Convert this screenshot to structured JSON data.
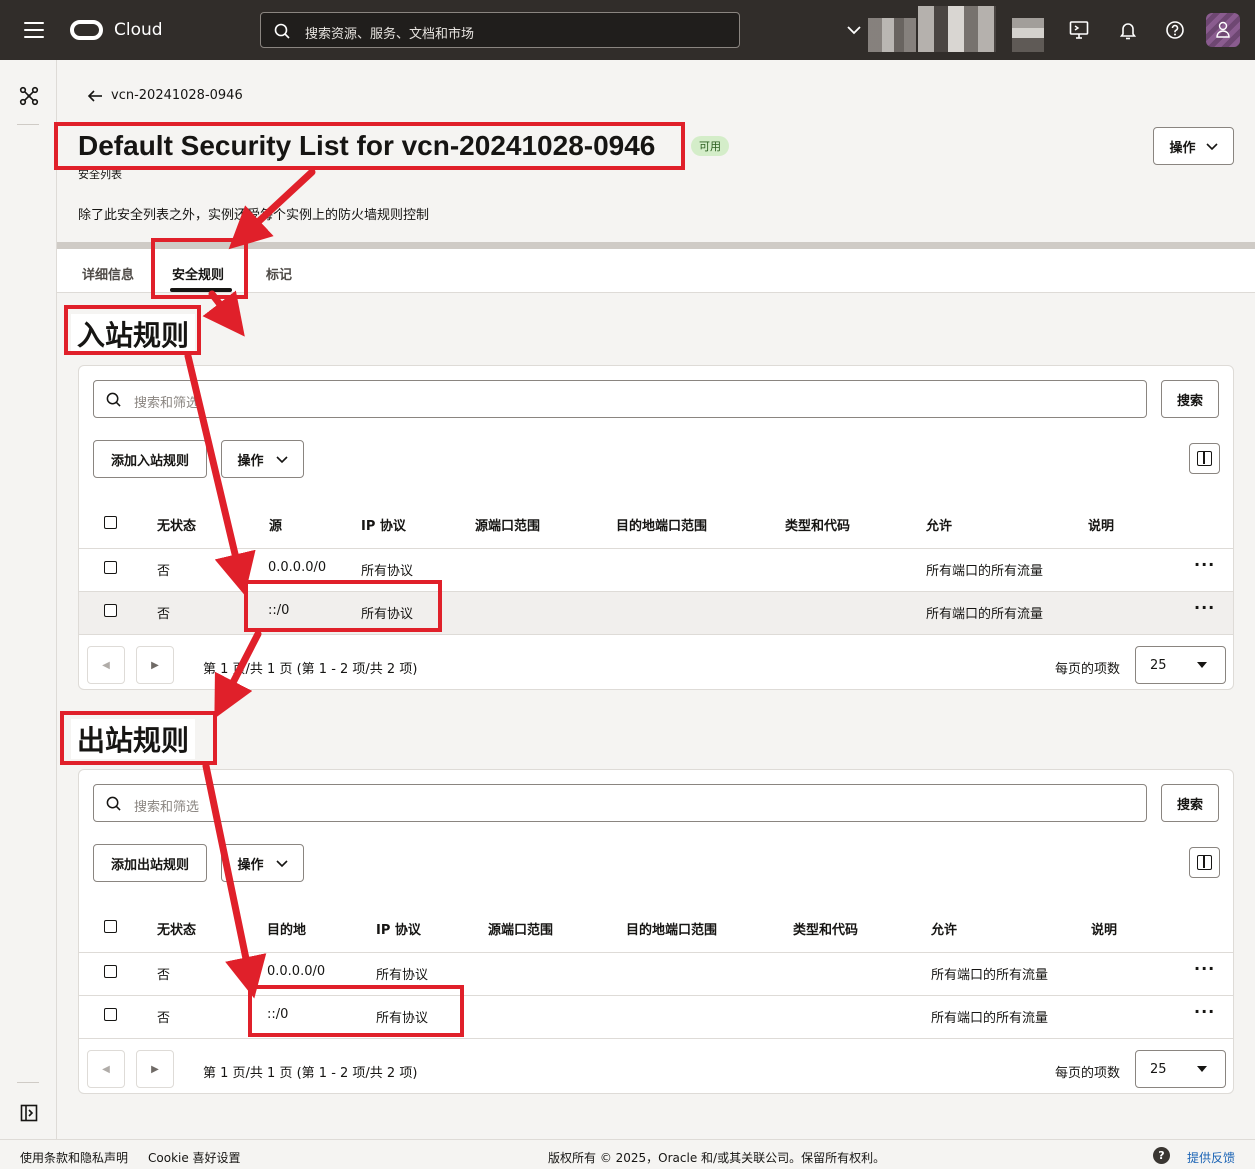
{
  "topbar": {
    "brand": "Cloud",
    "search_placeholder": "搜索资源、服务、文档和市场"
  },
  "breadcrumb": {
    "back_label": "vcn-20241028-0946"
  },
  "header": {
    "title": "Default Security List for vcn-20241028-0946",
    "status": "可用",
    "resource_type": "安全列表",
    "description": "除了此安全列表之外，实例还受每个实例上的防火墙规则控制",
    "actions_label": "操作"
  },
  "tabs": [
    {
      "label": "详细信息",
      "active": false
    },
    {
      "label": "安全规则",
      "active": true
    },
    {
      "label": "标记",
      "active": false
    }
  ],
  "annotations": {
    "ingress_heading": "入站规则",
    "egress_heading": "出站规则",
    "color": "#e0202a"
  },
  "ingress": {
    "search_placeholder": "搜索和筛选",
    "search_button": "搜索",
    "add_button": "添加入站规则",
    "actions_label": "操作",
    "columns": [
      "无状态",
      "源",
      "IP 协议",
      "源端口范围",
      "目的地端口范围",
      "类型和代码",
      "允许",
      "说明"
    ],
    "rows": [
      {
        "stateless": "否",
        "endpoint": "0.0.0.0/0",
        "protocol": "所有协议",
        "allows": "所有端口的所有流量"
      },
      {
        "stateless": "否",
        "endpoint": "::/0",
        "protocol": "所有协议",
        "allows": "所有端口的所有流量"
      }
    ],
    "pager_text": "第 1 页/共 1 页 (第 1 - 2 项/共 2 项)",
    "per_page_label": "每页的项数",
    "per_page_value": "25"
  },
  "egress": {
    "search_placeholder": "搜索和筛选",
    "search_button": "搜索",
    "add_button": "添加出站规则",
    "actions_label": "操作",
    "columns": [
      "无状态",
      "目的地",
      "IP 协议",
      "源端口范围",
      "目的地端口范围",
      "类型和代码",
      "允许",
      "说明"
    ],
    "rows": [
      {
        "stateless": "否",
        "endpoint": "0.0.0.0/0",
        "protocol": "所有协议",
        "allows": "所有端口的所有流量"
      },
      {
        "stateless": "否",
        "endpoint": "::/0",
        "protocol": "所有协议",
        "allows": "所有端口的所有流量"
      }
    ],
    "pager_text": "第 1 页/共 1 页 (第 1 - 2 项/共 2 项)",
    "per_page_label": "每页的项数",
    "per_page_value": "25"
  },
  "footer": {
    "terms": "使用条款和隐私声明",
    "cookie": "Cookie 喜好设置",
    "copyright": "版权所有 © 2025，Oracle 和/或其关联公司。保留所有权利。",
    "help": "?",
    "feedback": "提供反馈"
  }
}
